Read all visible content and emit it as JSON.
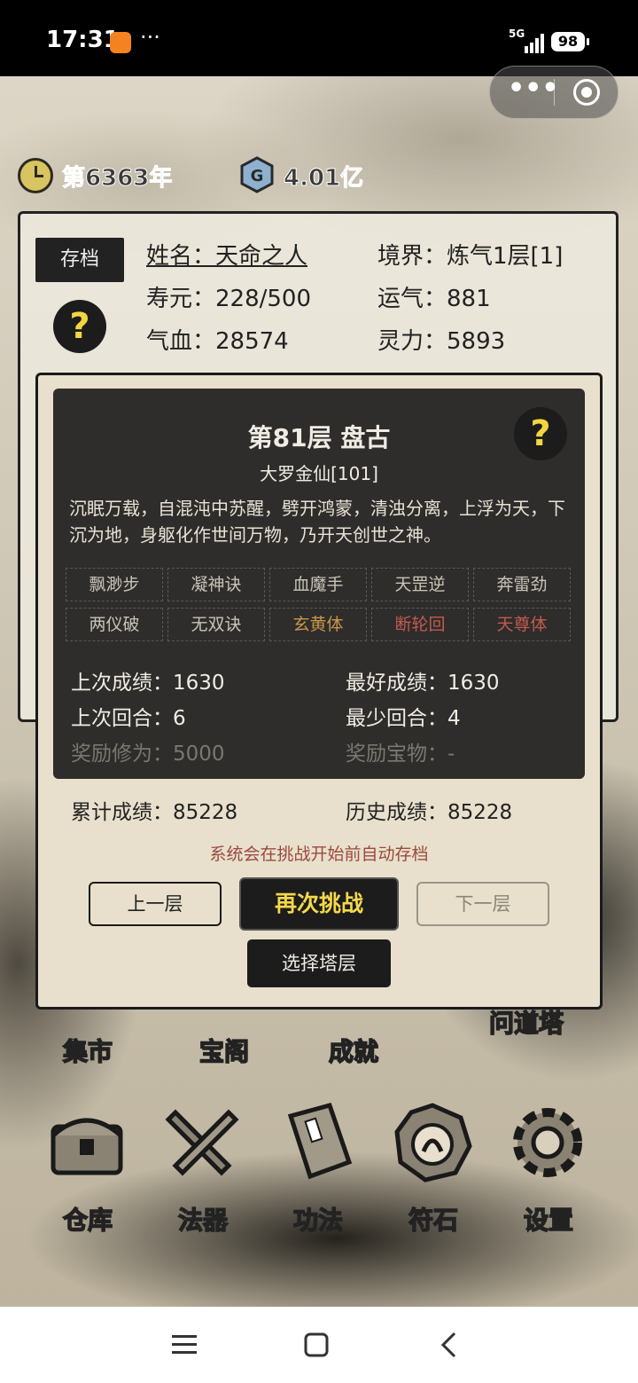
{
  "status_bar": {
    "time": "17:31",
    "network": "5G",
    "battery": "98",
    "more_dots": "···"
  },
  "capsule": {
    "more": "•••"
  },
  "top_info": {
    "year": "第6363年",
    "currency": "4.01亿"
  },
  "character": {
    "save_label": "存档",
    "help_symbol": "?",
    "stats": {
      "name": "姓名：天命之人",
      "realm": "境界：炼气1层[1]",
      "lifespan": "寿元：228/500",
      "luck": "运气：881",
      "hp": "气血：28574",
      "spirit": "灵力：5893"
    }
  },
  "tower_dialog": {
    "title": "第81层 盘古",
    "subtitle": "大罗金仙[101]",
    "help_symbol": "?",
    "description": "沉眠万载，自混沌中苏醒，劈开鸿蒙，清浊分离，上浮为天，下沉为地，身躯化作世间万物，乃开天创世之神。",
    "skills": [
      {
        "name": "飘渺步",
        "tone": "normal"
      },
      {
        "name": "凝神诀",
        "tone": "normal"
      },
      {
        "name": "血魔手",
        "tone": "normal"
      },
      {
        "name": "天罡逆",
        "tone": "normal"
      },
      {
        "name": "奔雷劲",
        "tone": "normal"
      },
      {
        "name": "两仪破",
        "tone": "normal"
      },
      {
        "name": "无双诀",
        "tone": "normal"
      },
      {
        "name": "玄黄体",
        "tone": "gold"
      },
      {
        "name": "断轮回",
        "tone": "red"
      },
      {
        "name": "天尊体",
        "tone": "red"
      }
    ],
    "last_score": "上次成绩：1630",
    "best_score": "最好成绩：1630",
    "last_rounds": "上次回合：6",
    "min_rounds": "最少回合：4",
    "reward_cultivation": "奖励修为：5000",
    "reward_treasure": "奖励宝物：-",
    "cumulative_score": "累计成绩：85228",
    "history_score": "历史成绩：85228",
    "notice": "系统会在挑战开始前自动存档",
    "prev_floor": "上一层",
    "challenge_again": "再次挑战",
    "next_floor": "下一层",
    "select_floor": "选择塔层"
  },
  "upper_menu": [
    "集市",
    "宝阁",
    "成就",
    "问道塔"
  ],
  "bottom_menu": [
    {
      "label": "仓库",
      "icon": "chest-icon"
    },
    {
      "label": "法器",
      "icon": "swords-icon"
    },
    {
      "label": "功法",
      "icon": "book-icon"
    },
    {
      "label": "符石",
      "icon": "rune-icon"
    },
    {
      "label": "设置",
      "icon": "gear-icon"
    }
  ],
  "colors": {
    "accent_yellow": "#f4d84a",
    "notice_red": "#9a4a3e",
    "panel_dark": "#2e2d2b",
    "dialog_bg": "#e8e0cc"
  }
}
